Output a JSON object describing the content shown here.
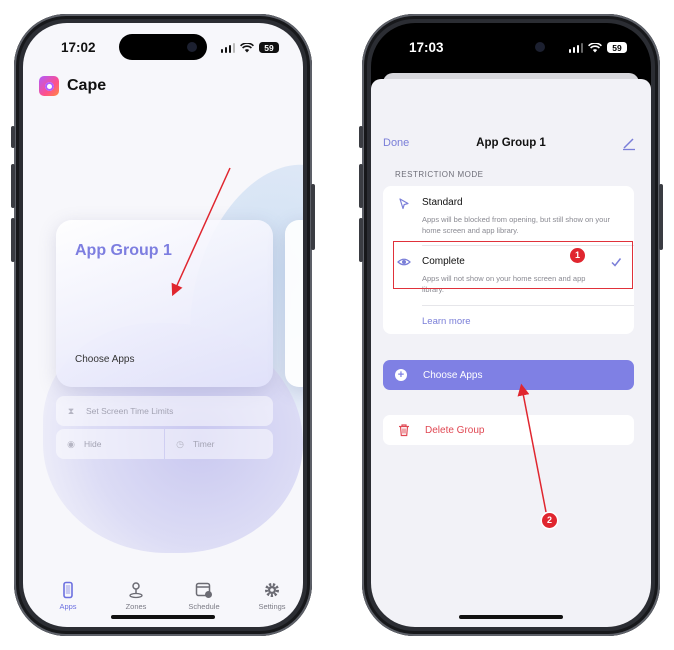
{
  "left_phone": {
    "status": {
      "time": "17:02",
      "battery": "59"
    },
    "app_name": "Cape",
    "card": {
      "title": "App Group 1",
      "subtitle": "Choose Apps"
    },
    "actions": {
      "screen_time": "Set Screen Time Limits",
      "hide": "Hide",
      "timer": "Timer"
    },
    "tabs": [
      {
        "label": "Apps",
        "icon": "phone-icon",
        "active": true
      },
      {
        "label": "Zones",
        "icon": "location-pin-icon",
        "active": false
      },
      {
        "label": "Schedule",
        "icon": "calendar-icon",
        "active": false
      },
      {
        "label": "Settings",
        "icon": "gear-icon",
        "active": false
      }
    ]
  },
  "right_phone": {
    "status": {
      "time": "17:03",
      "battery": "59"
    },
    "nav": {
      "done": "Done",
      "title": "App Group 1"
    },
    "section_header": "RESTRICTION MODE",
    "options": [
      {
        "title": "Standard",
        "description": "Apps will be blocked from opening, but still show on your home screen and app library.",
        "icon": "cursor-icon",
        "selected": false
      },
      {
        "title": "Complete",
        "description": "Apps will not show on your home screen and app library.",
        "icon": "eye-icon",
        "selected": true
      }
    ],
    "learn_more": "Learn more",
    "choose_apps": "Choose Apps",
    "delete_group": "Delete Group"
  },
  "annotations": {
    "badge_1": "1",
    "badge_2": "2"
  },
  "colors": {
    "accent": "#7f80e4",
    "danger": "#e04853",
    "annotation": "#e0262f"
  }
}
